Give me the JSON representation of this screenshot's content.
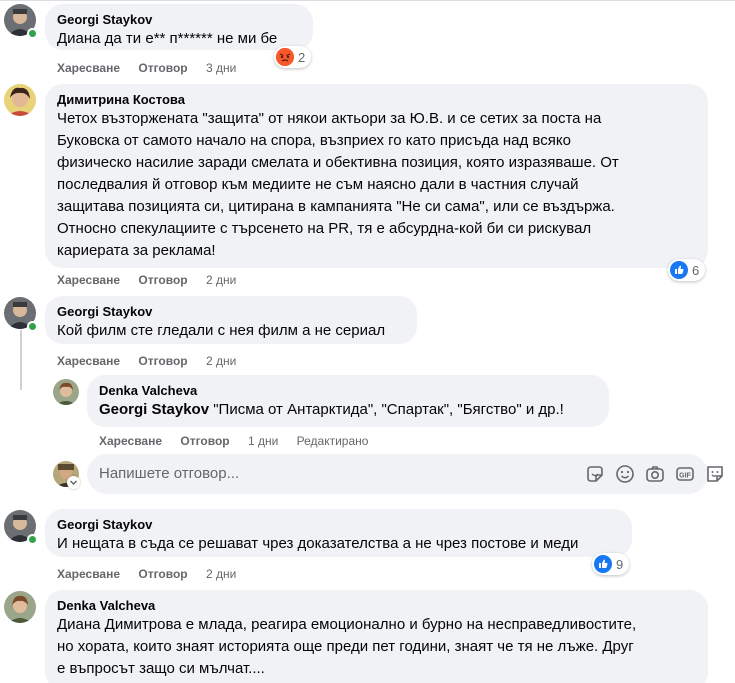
{
  "actions": {
    "like": "Харесване",
    "reply": "Отговор",
    "edited": "Редактирано"
  },
  "comments": [
    {
      "author": "Georgi Staykov",
      "text": "Диана да ти е** п****** не ми бе",
      "time": "3 дни",
      "reaction_count": "2",
      "reaction_type": "angry"
    },
    {
      "author": "Димитрина Костова",
      "lines": [
        "Четох възторжената \"защита\" от някои актьори за Ю.В. и се сетих за поста на",
        "Буковска от самото начало на спора, възприех го като присъда над всяко",
        "физическо насилие заради смелата и обективна позиция, която изразяваше. От",
        "последвалия й отговор към медиите не съм наясно дали в частния случай",
        "защитава позицията си, цитирана в кампанията \"Не си сама\", или се въздържа.",
        "Относно спекулациите с търсенето на PR, тя е абсурдна-кой би си рискувал",
        "кариерата за реклама!"
      ],
      "time": "2 дни",
      "reaction_count": "6",
      "reaction_type": "like"
    },
    {
      "author": "Georgi Staykov",
      "text": "Кой филм сте гледали с нея филм а не сериал",
      "time": "2 дни"
    },
    {
      "author": "Denka Valcheva",
      "mention": "Georgi Staykov",
      "text": " \"Писма от Антарктида\", \"Спартак\", \"Бягство\" и др.!",
      "time": "1 дни"
    },
    {
      "author": "Georgi Staykov",
      "text": "И нещата в съда се решават чрез доказателства а не чрез постове и меди",
      "time": "2 дни",
      "reaction_count": "9",
      "reaction_type": "like"
    },
    {
      "author": "Denka Valcheva",
      "lines": [
        "Диана Димитрова е млада, реагира емоционално и бурно на несправедливостите,",
        "но хората, които знаят историята още преди пет години, знаят че тя не лъже. Друг",
        "е въпросът защо си мълчат...."
      ]
    }
  ],
  "reply_box": {
    "placeholder": "Напишете отговор..."
  },
  "icons": {
    "tools": [
      "sticker-icon",
      "emoji-icon",
      "camera-icon",
      "gif-icon",
      "sticker-face-icon"
    ],
    "like_color": "#1877f2",
    "angry_color": "#f7592b",
    "online_color": "#31a24c"
  }
}
